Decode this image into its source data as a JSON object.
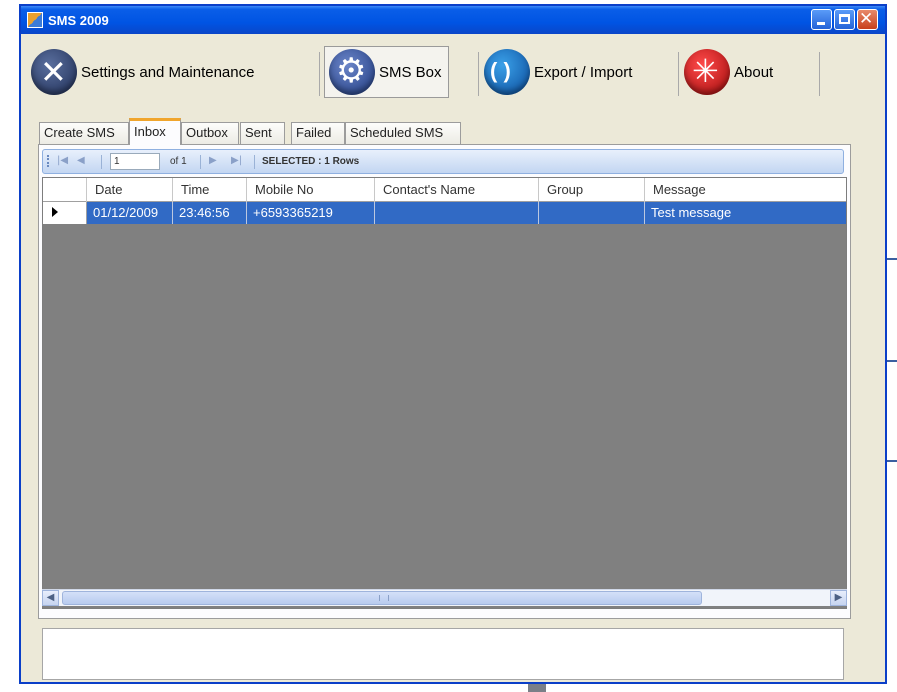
{
  "window": {
    "title": "SMS 2009"
  },
  "toolbar": {
    "settings_label": "Settings and Maintenance",
    "smsbox_label": "SMS Box",
    "export_label": "Export / Import",
    "about_label": "About"
  },
  "tabs": [
    {
      "label": "Create SMS"
    },
    {
      "label": "Inbox",
      "active": true
    },
    {
      "label": "Outbox"
    },
    {
      "label": "Sent"
    },
    {
      "label": "Failed"
    },
    {
      "label": "Scheduled SMS"
    }
  ],
  "navigator": {
    "position": "1",
    "of_text": "of 1",
    "selected_text": "SELECTED : 1 Rows"
  },
  "grid": {
    "columns": [
      "Date",
      "Time",
      "Mobile No",
      "Contact's Name",
      "Group",
      "Message"
    ],
    "rows": [
      {
        "date": "01/12/2009",
        "time": "23:46:56",
        "mobile": "+6593365219",
        "contact": "",
        "group": "",
        "message": "Test message",
        "selected": true
      }
    ]
  },
  "colors": {
    "title_bar": "#0054e3",
    "selection": "#316ac5",
    "active_tab_accent": "#f0a52c",
    "grid_empty_area": "#808080"
  }
}
